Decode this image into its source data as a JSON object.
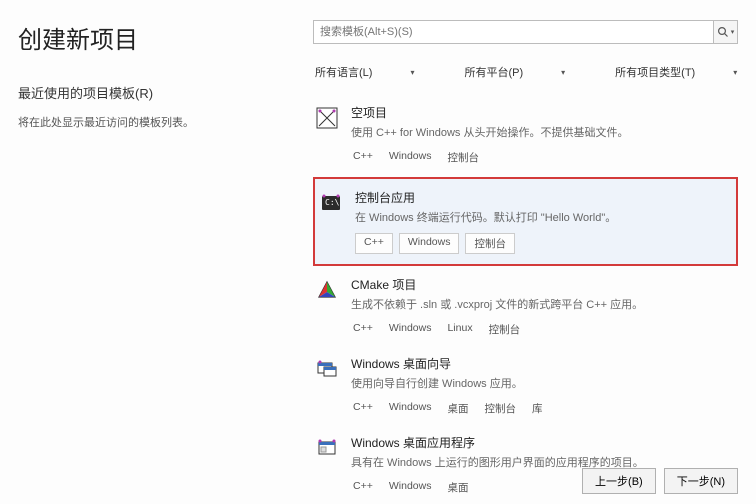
{
  "title": "创建新项目",
  "recent_label": "最近使用的项目模板(R)",
  "recent_hint": "将在此处显示最近访问的模板列表。",
  "search_placeholder": "搜索模板(Alt+S)(S)",
  "filters": {
    "language": "所有语言(L)",
    "platform": "所有平台(P)",
    "type": "所有项目类型(T)"
  },
  "templates": [
    {
      "title": "空项目",
      "desc": "使用 C++ for Windows 从头开始操作。不提供基础文件。",
      "tags": [
        "C++",
        "Windows",
        "控制台"
      ],
      "tag_style": "plain"
    },
    {
      "title": "控制台应用",
      "desc": "在 Windows 终端运行代码。默认打印 \"Hello World\"。",
      "tags": [
        "C++",
        "Windows",
        "控制台"
      ],
      "tag_style": "box",
      "highlight": true
    },
    {
      "title": "CMake 项目",
      "desc": "生成不依赖于 .sln 或 .vcxproj 文件的新式跨平台 C++ 应用。",
      "tags": [
        "C++",
        "Windows",
        "Linux",
        "控制台"
      ],
      "tag_style": "plain"
    },
    {
      "title": "Windows 桌面向导",
      "desc": "使用向导自行创建 Windows 应用。",
      "tags": [
        "C++",
        "Windows",
        "桌面",
        "控制台",
        "库"
      ],
      "tag_style": "plain"
    },
    {
      "title": "Windows 桌面应用程序",
      "desc": "具有在 Windows 上运行的图形用户界面的应用程序的项目。",
      "tags": [
        "C++",
        "Windows",
        "桌面"
      ],
      "tag_style": "plain"
    }
  ],
  "buttons": {
    "back": "上一步(B)",
    "next": "下一步(N)"
  }
}
